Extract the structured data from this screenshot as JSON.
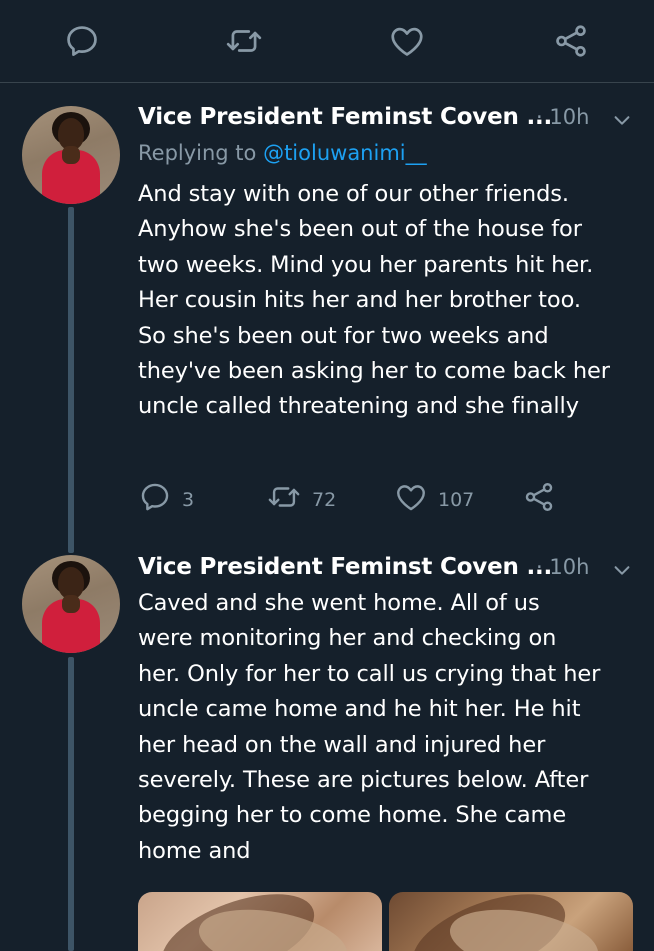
{
  "top_actions": [
    {
      "name": "reply-icon",
      "label": ""
    },
    {
      "name": "retweet-icon",
      "label": ""
    },
    {
      "name": "like-icon",
      "label": ""
    },
    {
      "name": "share-icon",
      "label": ""
    }
  ],
  "tweets": [
    {
      "author": "Vice President Feminst Coven ...",
      "time": "· 10h",
      "replying_prefix": "Replying to ",
      "replying_handle": "@tioluwanimi__",
      "text": "And stay with one of our other friends.\nAnyhow she's been out of the house for\ntwo weeks. Mind you her parents hit her.\nHer cousin hits her and her brother too.\nSo she's been out for two weeks and\nthey've been asking her to come back her\nuncle called threatening and she finally",
      "reply_count": "3",
      "retweet_count": "72",
      "like_count": "107"
    },
    {
      "author": "Vice President Feminst Coven ...",
      "time": "· 10h",
      "text": "Caved and she went home. All of us\nwere monitoring her and checking on\nher. Only for her to call us crying that her\nuncle came home and he hit her. He hit\nher head on the wall and injured her\nseverely. These are pictures below. After\nbegging her to come home. She came\nhome and"
    }
  ],
  "colors": {
    "background": "#15202b",
    "secondary_text": "#8899a6",
    "link": "#1da1f2",
    "thread_line": "#3d5466"
  }
}
